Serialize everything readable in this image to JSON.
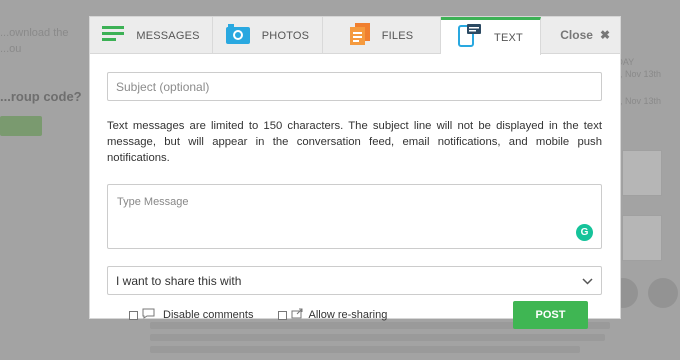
{
  "background": {
    "left_snippets": [
      "...ownload the",
      "...ou"
    ],
    "heading": "...roup code?",
    "right_today": "TODAY",
    "right_dates": [
      "Sun, Nov 13th",
      "Sun, Nov 13th"
    ],
    "tiles": [
      "liv",
      "liv"
    ]
  },
  "tabs": [
    {
      "label": "MESSAGES",
      "icon": "messages-icon"
    },
    {
      "label": "PHOTOS",
      "icon": "camera-icon"
    },
    {
      "label": "FILES",
      "icon": "files-icon"
    },
    {
      "label": "TEXT",
      "icon": "text-phone-icon",
      "active": true
    }
  ],
  "close_label": "Close",
  "subject": {
    "placeholder": "Subject (optional)"
  },
  "notice": "Text messages are limited to 150 characters. The subject line will not be displayed in the text message, but will appear in the conversation feed, email notifications, and mobile push notifications.",
  "message": {
    "placeholder": "Type Message"
  },
  "share": {
    "label": "I want to share this with"
  },
  "options": {
    "disable_comments": "Disable comments",
    "allow_resharing": "Allow re-sharing"
  },
  "post_label": "POST",
  "colors": {
    "accent": "#3cb155",
    "post": "#3fb653",
    "grammarly": "#15c39a"
  }
}
